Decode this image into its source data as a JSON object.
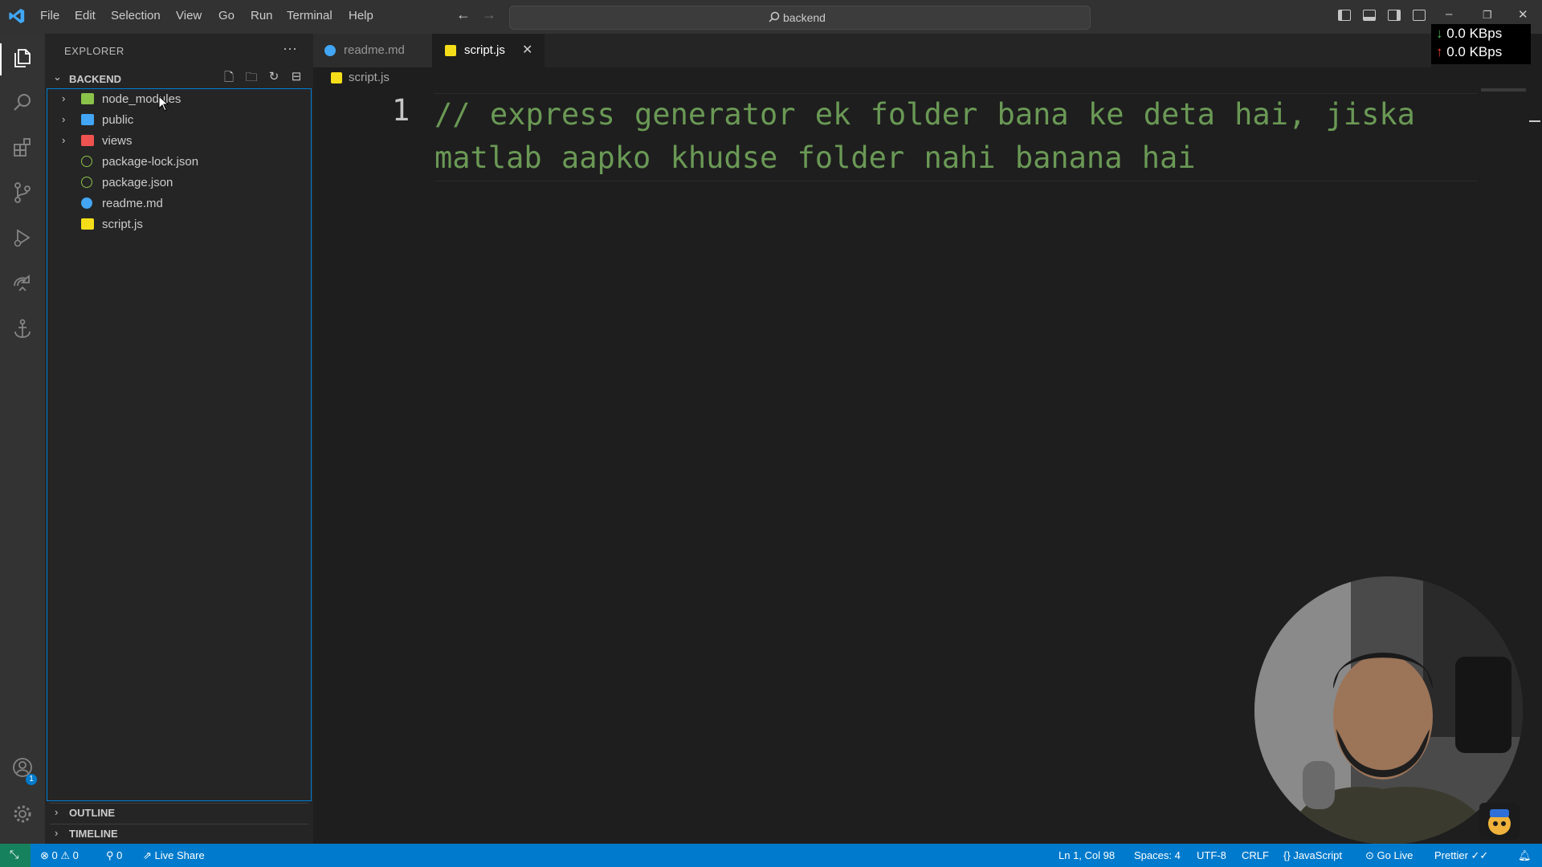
{
  "menu": [
    "File",
    "Edit",
    "Selection",
    "View",
    "Go",
    "Run",
    "Terminal",
    "Help"
  ],
  "command_center": {
    "label": "backend"
  },
  "network": {
    "down": "0.0 KBps",
    "up": "0.0 KBps"
  },
  "sidebar": {
    "title": "EXPLORER",
    "folder": "BACKEND",
    "tree": [
      {
        "name": "node_modules",
        "type": "folder",
        "icon_color": "#8bc34a"
      },
      {
        "name": "public",
        "type": "folder",
        "icon_color": "#42a5f5"
      },
      {
        "name": "views",
        "type": "folder",
        "icon_color": "#ef5350"
      },
      {
        "name": "package-lock.json",
        "type": "file",
        "icon_color": "#8bc34a"
      },
      {
        "name": "package.json",
        "type": "file",
        "icon_color": "#8bc34a"
      },
      {
        "name": "readme.md",
        "type": "file",
        "icon_color": "#42a5f5"
      },
      {
        "name": "script.js",
        "type": "file",
        "icon_color": "#f5de19"
      }
    ],
    "sections": [
      "OUTLINE",
      "TIMELINE"
    ]
  },
  "tabs": [
    {
      "name": "readme.md",
      "active": false,
      "icon": "info-icon"
    },
    {
      "name": "script.js",
      "active": true,
      "icon": "js-icon"
    }
  ],
  "breadcrumb": "script.js",
  "editor": {
    "line_number": "1",
    "code": "// express generator ek folder bana ke deta hai, jiska matlab aapko khudse folder nahi banana hai"
  },
  "statusbar": {
    "errors": "0",
    "warnings": "0",
    "ports": "0",
    "live_share": "Live Share",
    "position": "Ln 1, Col 98",
    "spaces": "Spaces: 4",
    "encoding": "UTF-8",
    "eol": "CRLF",
    "language": "JavaScript",
    "go_live": "Go Live",
    "prettier": "Prettier"
  },
  "accounts_badge": "1",
  "colors": {
    "accent": "#007acc",
    "comment": "#6a9955",
    "focus_border": "#007fd4"
  }
}
